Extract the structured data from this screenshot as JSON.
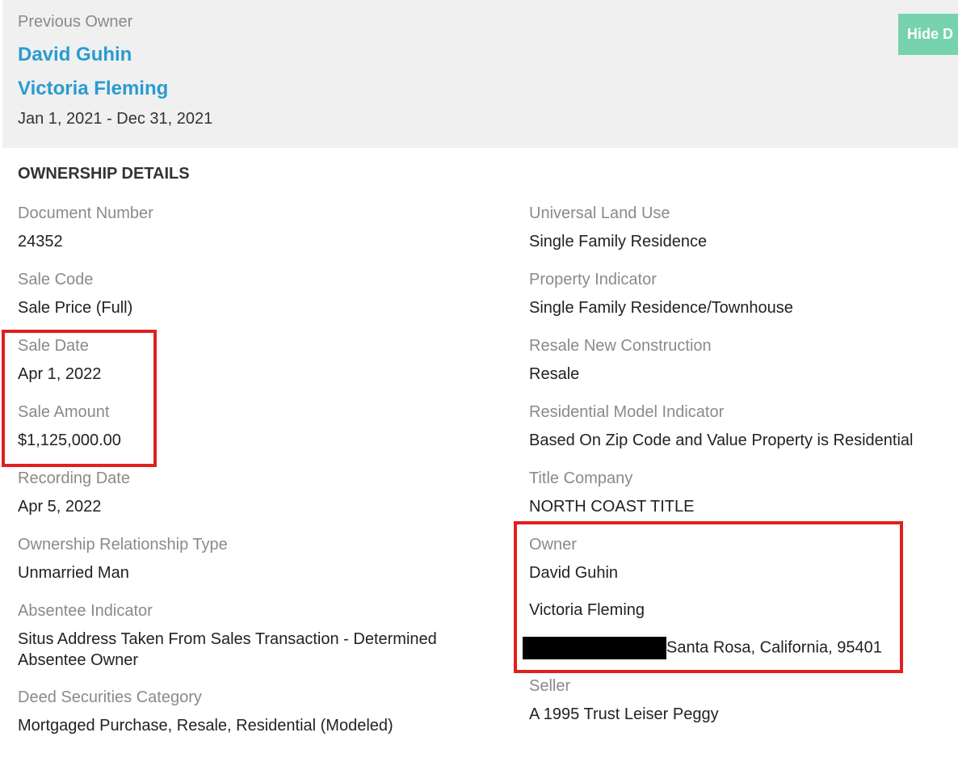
{
  "previous_owner": {
    "label": "Previous Owner",
    "names": [
      "David Guhin",
      "Victoria Fleming"
    ],
    "date_range": "Jan 1, 2021 - Dec 31, 2021",
    "hide_button_label": "Hide D"
  },
  "ownership": {
    "section_title": "OWNERSHIP DETAILS",
    "document_number": {
      "label": "Document Number",
      "value": "24352"
    },
    "sale_code": {
      "label": "Sale Code",
      "value": "Sale Price (Full)"
    },
    "sale_date": {
      "label": "Sale Date",
      "value": "Apr 1, 2022"
    },
    "sale_amount": {
      "label": "Sale Amount",
      "value": "$1,125,000.00"
    },
    "recording_date": {
      "label": "Recording Date",
      "value": "Apr 5, 2022"
    },
    "ownership_relationship_type": {
      "label": "Ownership Relationship Type",
      "value": "Unmarried Man"
    },
    "absentee_indicator": {
      "label": "Absentee Indicator",
      "value": "Situs Address Taken From Sales Transaction - Determined Absentee Owner"
    },
    "deed_securities_category": {
      "label": "Deed Securities Category",
      "value": "Mortgaged Purchase, Resale, Residential (Modeled)"
    },
    "universal_land_use": {
      "label": "Universal Land Use",
      "value": "Single Family Residence"
    },
    "property_indicator": {
      "label": "Property Indicator",
      "value": "Single Family Residence/Townhouse"
    },
    "resale_new_construction": {
      "label": "Resale New Construction",
      "value": "Resale"
    },
    "residential_model_indicator": {
      "label": "Residential Model Indicator",
      "value": "Based On Zip Code and Value Property is Residential"
    },
    "title_company": {
      "label": "Title Company",
      "value": "NORTH COAST TITLE"
    },
    "owner": {
      "label": "Owner",
      "names": [
        "David Guhin",
        "Victoria Fleming"
      ],
      "address_visible": "Santa Rosa, California, 95401"
    },
    "seller": {
      "label": "Seller",
      "value": "A 1995 Trust Leiser Peggy"
    }
  },
  "colors": {
    "link_blue": "#2a9bd1",
    "button_green": "#76d3ad",
    "highlight_red": "#e0201e",
    "label_gray": "#8a8a8a",
    "header_bg": "#f0f0f0"
  }
}
